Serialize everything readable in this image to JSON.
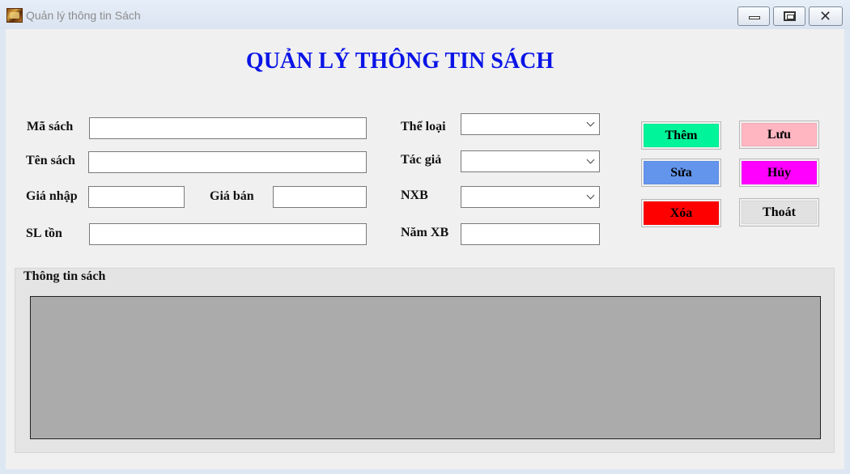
{
  "window": {
    "title": "Quản lý thông tin Sách",
    "icon": "app-books-icon",
    "controls": {
      "minimize": "minimize-icon",
      "maximize": "maximize-icon",
      "close": "✕"
    }
  },
  "heading": "QUẢN LÝ THÔNG TIN SÁCH",
  "form": {
    "ma_sach": {
      "label": "Mã sách",
      "value": ""
    },
    "ten_sach": {
      "label": "Tên sách",
      "value": ""
    },
    "gia_nhap": {
      "label": "Giá nhập",
      "value": ""
    },
    "gia_ban": {
      "label": "Giá bán",
      "value": ""
    },
    "sl_ton": {
      "label": "SL tồn",
      "value": ""
    },
    "the_loai": {
      "label": "Thể loại",
      "value": ""
    },
    "tac_gia": {
      "label": "Tác giả",
      "value": ""
    },
    "nxb": {
      "label": "NXB",
      "value": ""
    },
    "nam_xb": {
      "label": "Năm XB",
      "value": ""
    }
  },
  "buttons": {
    "them": {
      "label": "Thêm",
      "color": "#00f59a"
    },
    "luu": {
      "label": "Lưu",
      "color": "#ffb6c1"
    },
    "sua": {
      "label": "Sửa",
      "color": "#6495ed"
    },
    "huy": {
      "label": "Hủy",
      "color": "#ff00ff"
    },
    "xoa": {
      "label": "Xóa",
      "color": "#ff0000"
    },
    "thoat": {
      "label": "Thoát",
      "color": "#e1e1e1"
    }
  },
  "group": {
    "title": "Thông tin sách"
  },
  "colors": {
    "heading": "#0a14e6",
    "grid_background": "#ababab",
    "form_background": "#f0f0f0"
  }
}
